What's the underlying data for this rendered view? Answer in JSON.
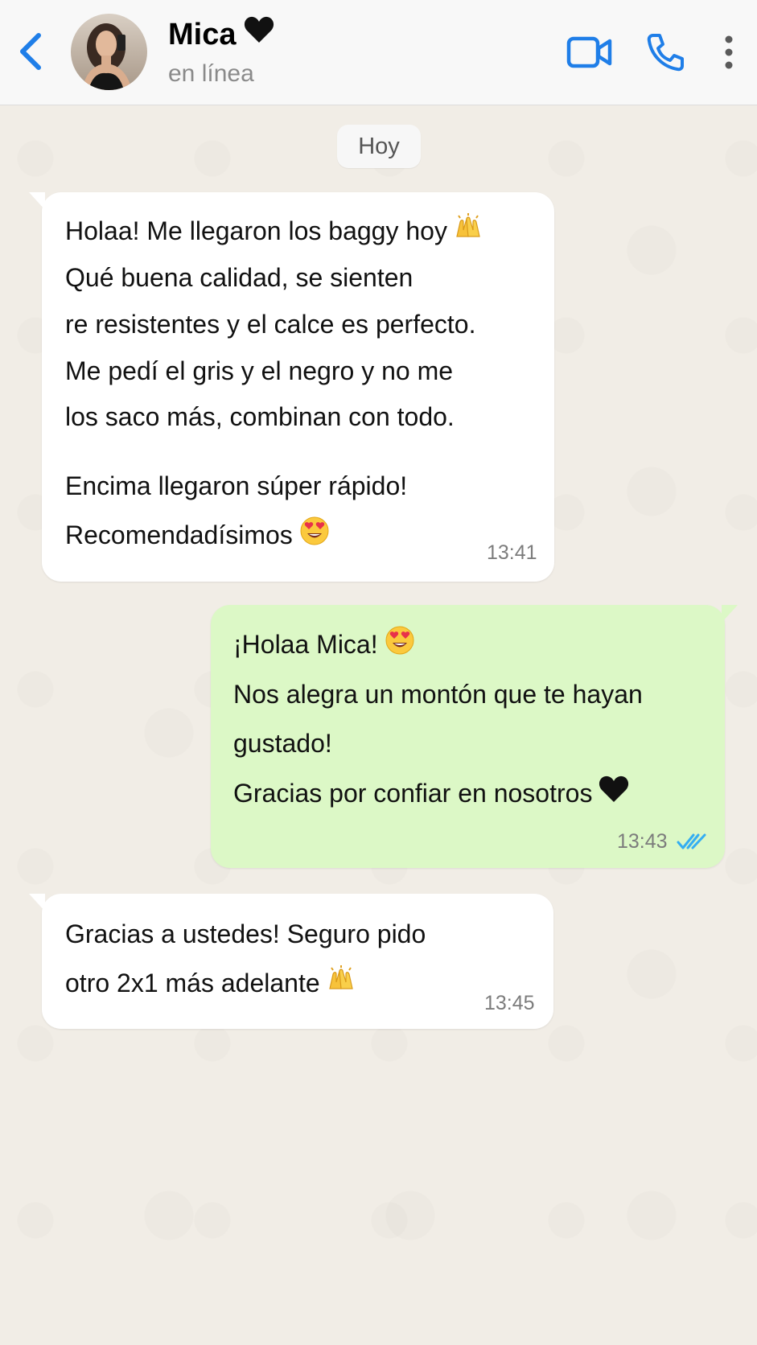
{
  "header": {
    "contact_name": "Mica",
    "status": "en línea",
    "icons": {
      "back": "chevron-left-icon",
      "name_suffix": "black-heart-icon",
      "video": "video-camera-icon",
      "call": "phone-icon",
      "menu": "more-vertical-icon"
    }
  },
  "chat": {
    "date_label": "Hoy",
    "messages": [
      {
        "direction": "incoming",
        "lines": [
          "Holaa! Me llegaron los baggy hoy",
          "Qué buena calidad, se sienten",
          "re resistentes y el calce es perfecto.",
          "Me pedí el gris y el negro y no me",
          "los saco más, combinan con todo.",
          "Encima llegaron súper rápido!",
          "Recomendadísimos"
        ],
        "emojis": [
          "raising-hands-emoji",
          "heart-eyes-emoji"
        ],
        "time": "13:41"
      },
      {
        "direction": "outgoing",
        "lines": [
          "¡Holaa Mica!",
          "Nos alegra un montón que te hayan",
          "gustado!",
          "Gracias por confiar en nosotros"
        ],
        "emojis": [
          "heart-eyes-emoji",
          "black-heart-icon"
        ],
        "time": "13:43",
        "status": "read-double-check"
      },
      {
        "direction": "incoming",
        "lines": [
          "Gracias a ustedes! Seguro pido",
          "otro 2x1 más adelante"
        ],
        "emojis": [
          "raising-hands-emoji"
        ],
        "time": "13:45"
      }
    ]
  },
  "colors": {
    "accent": "#1f7ee8",
    "incoming_bubble": "#ffffff",
    "outgoing_bubble": "#dcf8c6",
    "read_ticks": "#34aef2",
    "chat_background": "#f1ede6"
  }
}
